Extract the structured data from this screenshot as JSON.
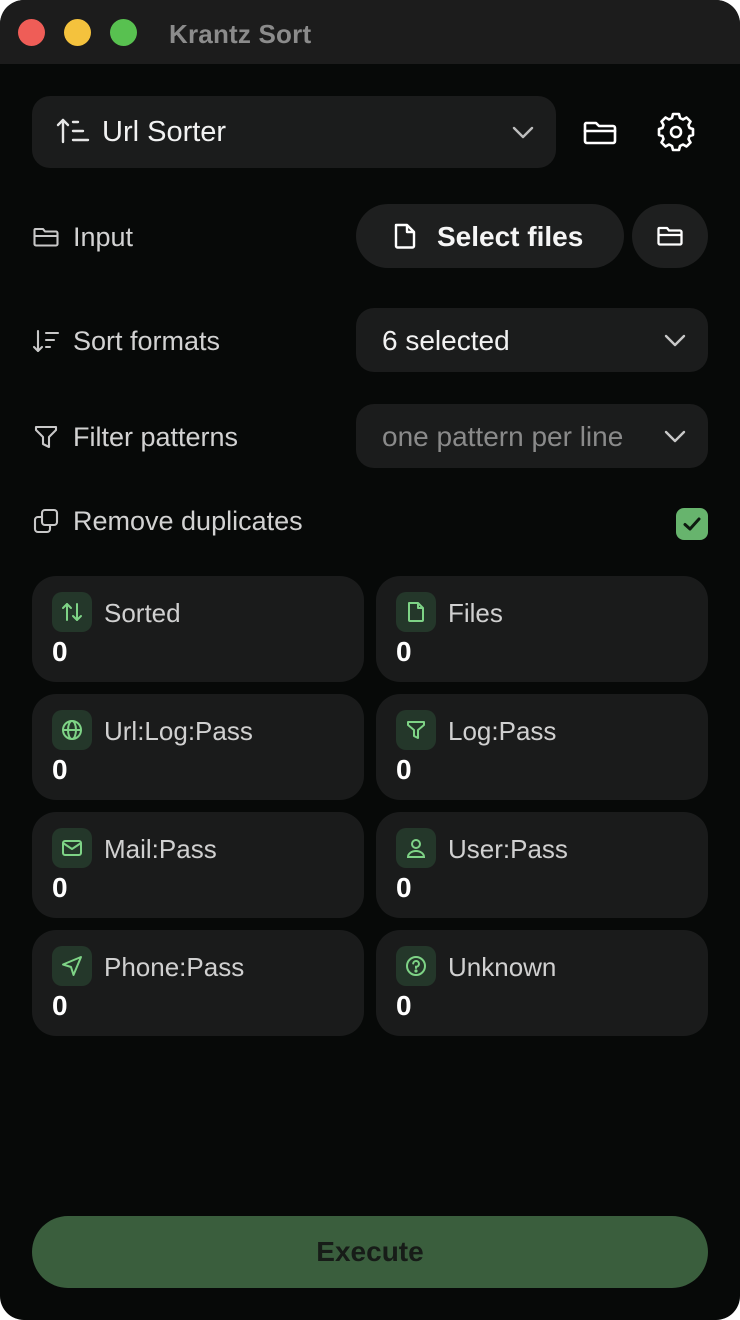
{
  "window": {
    "title": "Krantz Sort",
    "traffic_lights": {
      "close": "#ef5d57",
      "minimize": "#f4c23d",
      "maximize": "#58c150"
    }
  },
  "mode_selector": {
    "label": "Url Sorter",
    "icon": "sort-ascending-icon"
  },
  "header_icons": {
    "open_folder": "folder-icon",
    "settings": "gear-icon"
  },
  "input": {
    "label": "Input",
    "icon": "folder-icon",
    "select_files_label": "Select files",
    "select_files_icon": "file-icon",
    "select_folder_icon": "folder-icon"
  },
  "sort_formats": {
    "label": "Sort formats",
    "icon": "sort-descending-icon",
    "value": "6 selected"
  },
  "filter_patterns": {
    "label": "Filter patterns",
    "icon": "filter-icon",
    "placeholder": "one pattern per line"
  },
  "remove_duplicates": {
    "label": "Remove duplicates",
    "icon": "copy-icon",
    "checked": true
  },
  "stats": [
    {
      "label": "Sorted",
      "value": "0",
      "icon": "arrows-up-down-icon"
    },
    {
      "label": "Files",
      "value": "0",
      "icon": "file-icon"
    },
    {
      "label": "Url:Log:Pass",
      "value": "0",
      "icon": "globe-icon"
    },
    {
      "label": "Log:Pass",
      "value": "0",
      "icon": "filter-icon"
    },
    {
      "label": "Mail:Pass",
      "value": "0",
      "icon": "mail-icon"
    },
    {
      "label": "User:Pass",
      "value": "0",
      "icon": "user-icon"
    },
    {
      "label": "Phone:Pass",
      "value": "0",
      "icon": "send-icon"
    },
    {
      "label": "Unknown",
      "value": "0",
      "icon": "question-circle-icon"
    }
  ],
  "execute": {
    "label": "Execute"
  },
  "colors": {
    "accent": "#67b46d",
    "icon_green": "#7ed386",
    "execute_bg": "#3a5e3d",
    "card_bg": "#1a1b1b",
    "window_bg": "#070908"
  }
}
